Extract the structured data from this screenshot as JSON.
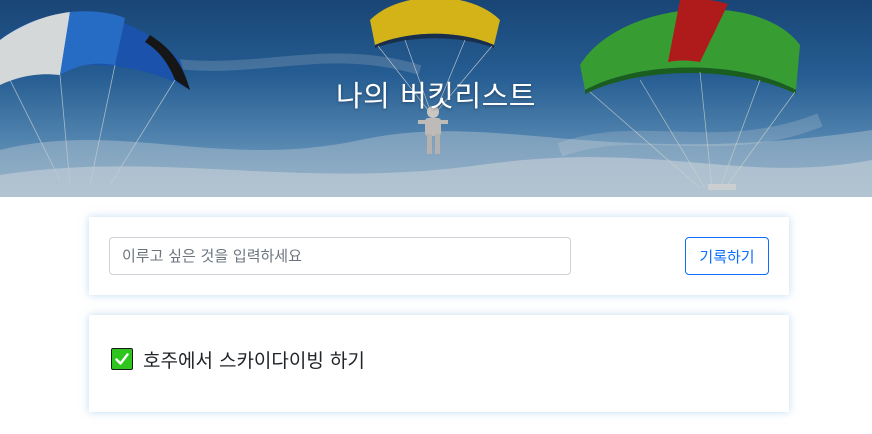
{
  "hero": {
    "title": "나의 버킷리스트"
  },
  "form": {
    "input_placeholder": "이루고 싶은 것을 입력하세요",
    "input_value": "",
    "submit_label": "기록하기"
  },
  "list": {
    "items": [
      {
        "checked": true,
        "icon": "check-mark-icon",
        "text": "호주에서 스카이다이빙 하기"
      }
    ]
  },
  "colors": {
    "accent": "#0d6efd",
    "check_green": "#2fc51f"
  }
}
